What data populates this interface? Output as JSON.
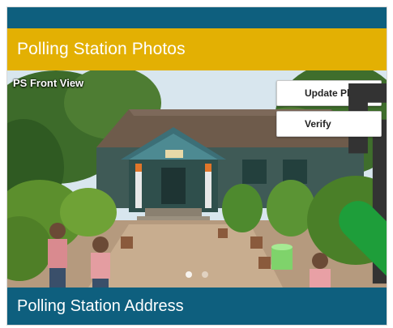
{
  "header": {
    "title": "Polling Station Photos"
  },
  "photo": {
    "caption": "PS Front View",
    "actions": [
      {
        "label": "Update Photo",
        "icon": "update-photo-icon"
      },
      {
        "label": "Verify",
        "icon": "check-icon"
      }
    ],
    "pager": {
      "count": 2,
      "active_index": 0
    }
  },
  "footer": {
    "title": "Polling Station Address"
  },
  "colors": {
    "topbar": "#0e5f7e",
    "header": "#e3b003",
    "footer": "#0e5f7e",
    "verify_check": "#1e9e3a"
  }
}
